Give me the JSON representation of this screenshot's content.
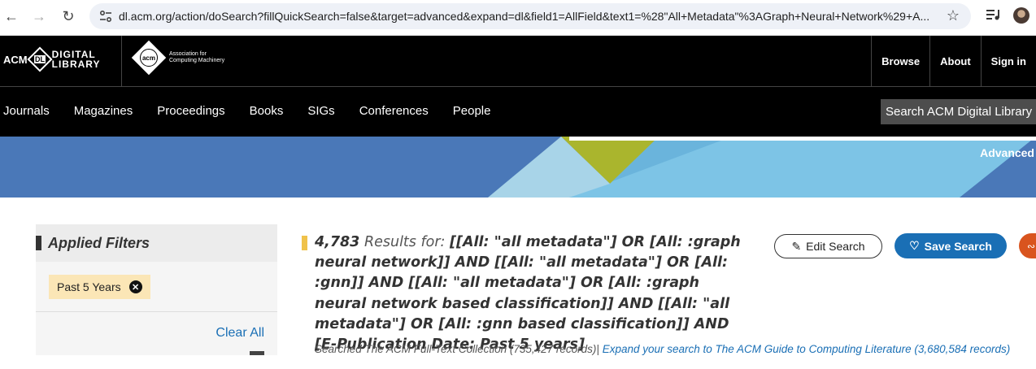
{
  "browser": {
    "url": "dl.acm.org/action/doSearch?fillQuickSearch=false&target=advanced&expand=dl&field1=AllField&text1=%28\"All+Metadata\"%3AGraph+Neural+Network%29+A..."
  },
  "header": {
    "dl_logo_acm": "ACM",
    "dl_logo_badge": "DL",
    "dl_logo_line1": "DIGITAL",
    "dl_logo_line2": "LIBRARY",
    "acm_badge": "acm",
    "acm_line1": "Association for",
    "acm_line2": "Computing Machinery",
    "top_links": [
      "Browse",
      "About",
      "Sign in"
    ],
    "nav": [
      "Journals",
      "Magazines",
      "Proceedings",
      "Books",
      "SIGs",
      "Conferences",
      "People"
    ],
    "search_label": "Search ACM Digital Library",
    "advanced": "Advanced"
  },
  "filters": {
    "title": "Applied Filters",
    "chips": [
      "Past 5 Years"
    ],
    "clear_all": "Clear All"
  },
  "results": {
    "count": "4,783",
    "label": "Results for:",
    "query": "[[All: \"all metadata\"] OR [All: :graph neural network]] AND [[All: \"all metadata\"] OR [All: :gnn]] AND [[All: \"all metadata\"] OR [All: :graph neural network based classification]] AND [[All: \"all metadata\"] OR [All: :gnn based classification]] AND [E-Publication Date: Past 5 years]",
    "edit_search": "Edit Search",
    "save_search": "Save Search",
    "searched_text": "Searched The ACM Full-Text Collection (735,427 records)",
    "separator": "|",
    "expand_link": "Expand your search to The ACM Guide to Computing Literature (3,680,584 records)"
  },
  "colors": {
    "header_bg": "#000000",
    "banner_blue": "#4a78b8",
    "accent_blue": "#1a6fb5",
    "chip_bg": "#fbe6b6",
    "rss": "#d9541e",
    "result_marker": "#f0c24a"
  }
}
